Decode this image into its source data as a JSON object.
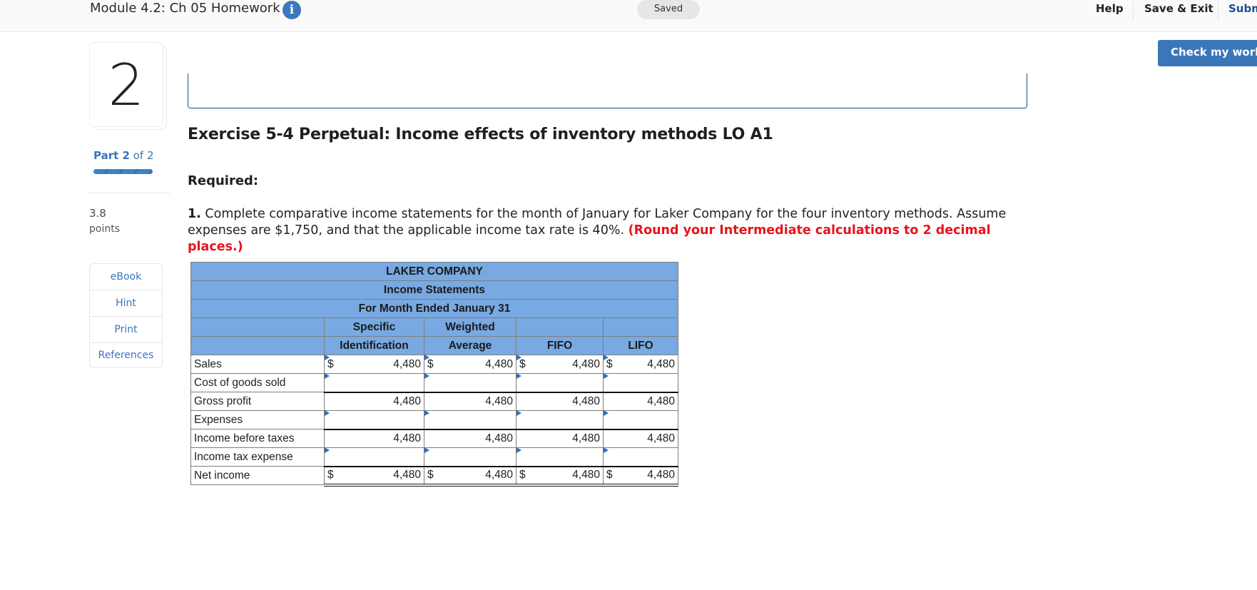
{
  "header": {
    "module_title": "Module 4.2: Ch 05 Homework",
    "info_icon": "info-icon",
    "saved_status": "Saved",
    "links": {
      "help": "Help",
      "save_exit": "Save & Exit",
      "submit": "Subm"
    }
  },
  "check_my_work": "Check my work",
  "question": {
    "number": "2",
    "part_prefix": "Part",
    "part_current": "2",
    "part_suffix": "of 2",
    "part_progress": 1.0,
    "points_value": "3.8",
    "points_label": "points"
  },
  "tools": [
    {
      "label": "eBook"
    },
    {
      "label": "Hint"
    },
    {
      "label": "Print"
    },
    {
      "label": "References"
    }
  ],
  "exercise": {
    "title": "Exercise 5-4 Perpetual: Income effects of inventory methods LO A1",
    "required_label": "Required:",
    "instruction_num": "1.",
    "instruction_text": " Complete comparative income statements for the month of January for Laker Company for the four inventory methods. Assume expenses are $1,750, and that the applicable income tax rate is 40%. ",
    "instruction_note": "(Round your Intermediate calculations to 2 decimal places.)"
  },
  "statement": {
    "company": "LAKER COMPANY",
    "title": "Income Statements",
    "period": "For Month Ended January 31",
    "columns": [
      {
        "line1": "Specific",
        "line2": "Identification"
      },
      {
        "line1": "Weighted",
        "line2": "Average"
      },
      {
        "line1": "",
        "line2": "FIFO"
      },
      {
        "line1": "",
        "line2": "LIFO"
      }
    ],
    "currency": "$",
    "rows": [
      {
        "label": "Sales",
        "values": [
          "4,480",
          "4,480",
          "4,480",
          "4,480"
        ]
      },
      {
        "label": "Cost of goods sold",
        "values": [
          "",
          "",
          "",
          ""
        ]
      },
      {
        "label": "Gross profit",
        "values": [
          "4,480",
          "4,480",
          "4,480",
          "4,480"
        ]
      },
      {
        "label": "Expenses",
        "values": [
          "",
          "",
          "",
          ""
        ]
      },
      {
        "label": "Income before taxes",
        "values": [
          "4,480",
          "4,480",
          "4,480",
          "4,480"
        ]
      },
      {
        "label": "Income tax expense",
        "values": [
          "",
          "",
          "",
          ""
        ]
      },
      {
        "label": "Net income",
        "values": [
          "4,480",
          "4,480",
          "4,480",
          "4,480"
        ]
      }
    ]
  }
}
